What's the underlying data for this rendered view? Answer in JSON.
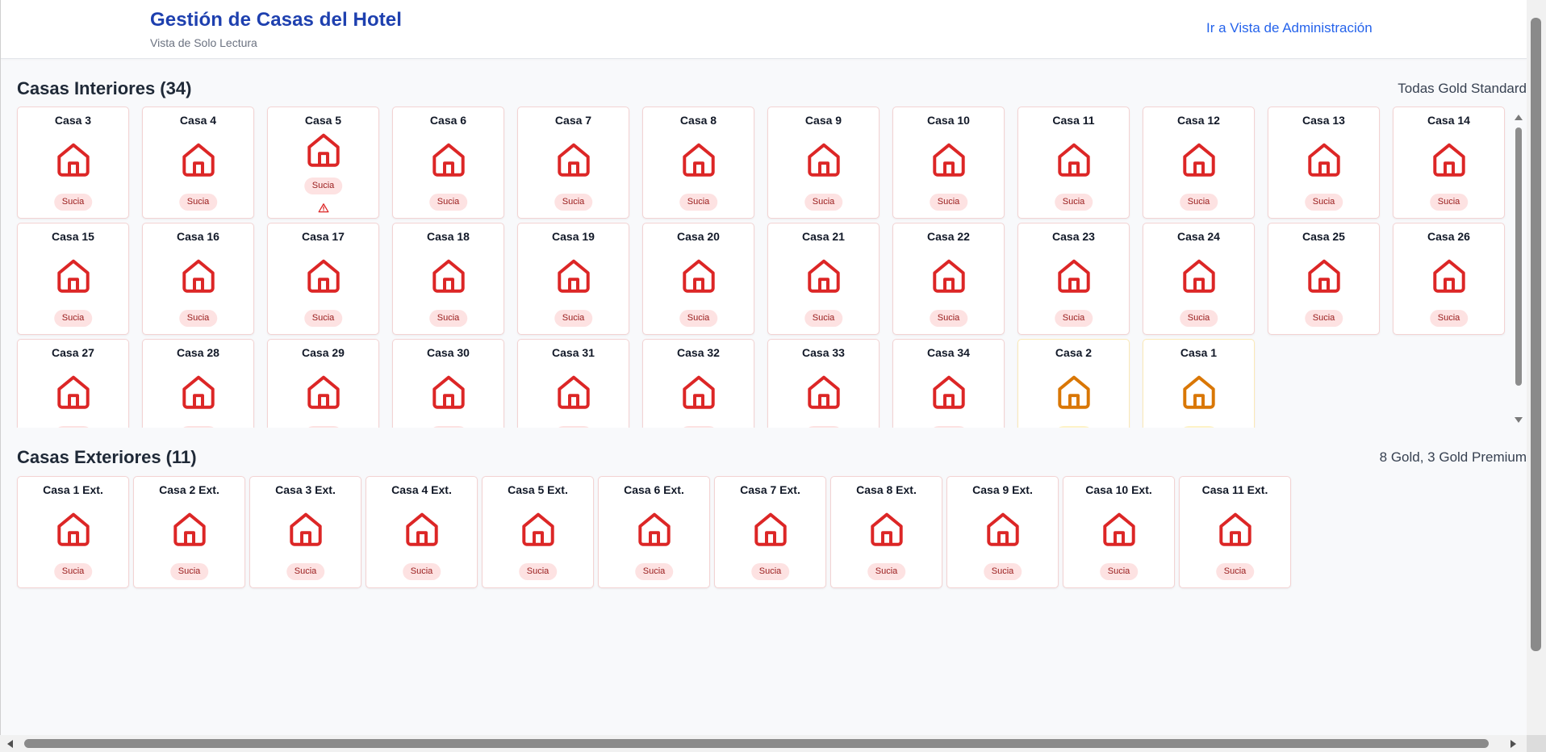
{
  "header": {
    "title": "Gestión de Casas del Hotel",
    "subtitle": "Vista de Solo Lectura",
    "admin_link": "Ir a Vista de Administración"
  },
  "colors": {
    "dirty_icon": "#dc2626",
    "warning_icon": "#d97706",
    "title_blue": "#1e40af",
    "link_blue": "#2563eb"
  },
  "interior": {
    "title": "Casas Interiores (34)",
    "meta": "Todas Gold Standard",
    "houses": [
      {
        "name": "Casa 3",
        "status": "Sucia",
        "tone": "red",
        "alert": false
      },
      {
        "name": "Casa 4",
        "status": "Sucia",
        "tone": "red",
        "alert": false
      },
      {
        "name": "Casa 5",
        "status": "Sucia",
        "tone": "red",
        "alert": true
      },
      {
        "name": "Casa 6",
        "status": "Sucia",
        "tone": "red",
        "alert": false
      },
      {
        "name": "Casa 7",
        "status": "Sucia",
        "tone": "red",
        "alert": false
      },
      {
        "name": "Casa 8",
        "status": "Sucia",
        "tone": "red",
        "alert": false
      },
      {
        "name": "Casa 9",
        "status": "Sucia",
        "tone": "red",
        "alert": false
      },
      {
        "name": "Casa 10",
        "status": "Sucia",
        "tone": "red",
        "alert": false
      },
      {
        "name": "Casa 11",
        "status": "Sucia",
        "tone": "red",
        "alert": false
      },
      {
        "name": "Casa 12",
        "status": "Sucia",
        "tone": "red",
        "alert": false
      },
      {
        "name": "Casa 13",
        "status": "Sucia",
        "tone": "red",
        "alert": false
      },
      {
        "name": "Casa 14",
        "status": "Sucia",
        "tone": "red",
        "alert": false
      },
      {
        "name": "Casa 15",
        "status": "Sucia",
        "tone": "red",
        "alert": false
      },
      {
        "name": "Casa 16",
        "status": "Sucia",
        "tone": "red",
        "alert": false
      },
      {
        "name": "Casa 17",
        "status": "Sucia",
        "tone": "red",
        "alert": false
      },
      {
        "name": "Casa 18",
        "status": "Sucia",
        "tone": "red",
        "alert": false
      },
      {
        "name": "Casa 19",
        "status": "Sucia",
        "tone": "red",
        "alert": false
      },
      {
        "name": "Casa 20",
        "status": "Sucia",
        "tone": "red",
        "alert": false
      },
      {
        "name": "Casa 21",
        "status": "Sucia",
        "tone": "red",
        "alert": false
      },
      {
        "name": "Casa 22",
        "status": "Sucia",
        "tone": "red",
        "alert": false
      },
      {
        "name": "Casa 23",
        "status": "Sucia",
        "tone": "red",
        "alert": false
      },
      {
        "name": "Casa 24",
        "status": "Sucia",
        "tone": "red",
        "alert": false
      },
      {
        "name": "Casa 25",
        "status": "Sucia",
        "tone": "red",
        "alert": false
      },
      {
        "name": "Casa 26",
        "status": "Sucia",
        "tone": "red",
        "alert": false
      },
      {
        "name": "Casa 27",
        "status": "",
        "tone": "red",
        "alert": false
      },
      {
        "name": "Casa 28",
        "status": "",
        "tone": "red",
        "alert": false
      },
      {
        "name": "Casa 29",
        "status": "",
        "tone": "red",
        "alert": false
      },
      {
        "name": "Casa 30",
        "status": "",
        "tone": "red",
        "alert": false
      },
      {
        "name": "Casa 31",
        "status": "",
        "tone": "red",
        "alert": false
      },
      {
        "name": "Casa 32",
        "status": "",
        "tone": "red",
        "alert": false
      },
      {
        "name": "Casa 33",
        "status": "",
        "tone": "red",
        "alert": false
      },
      {
        "name": "Casa 34",
        "status": "",
        "tone": "red",
        "alert": false
      },
      {
        "name": "Casa 2",
        "status": "",
        "tone": "yellow",
        "alert": false
      },
      {
        "name": "Casa 1",
        "status": "",
        "tone": "yellow",
        "alert": false
      }
    ]
  },
  "exterior": {
    "title": "Casas Exteriores (11)",
    "meta": "8 Gold, 3 Gold Premium",
    "houses": [
      {
        "name": "Casa 1 Ext.",
        "status": "Sucia",
        "tone": "red",
        "alert": false
      },
      {
        "name": "Casa 2 Ext.",
        "status": "Sucia",
        "tone": "red",
        "alert": false
      },
      {
        "name": "Casa 3 Ext.",
        "status": "Sucia",
        "tone": "red",
        "alert": false
      },
      {
        "name": "Casa 4 Ext.",
        "status": "Sucia",
        "tone": "red",
        "alert": false
      },
      {
        "name": "Casa 5 Ext.",
        "status": "Sucia",
        "tone": "red",
        "alert": false
      },
      {
        "name": "Casa 6 Ext.",
        "status": "Sucia",
        "tone": "red",
        "alert": false
      },
      {
        "name": "Casa 7 Ext.",
        "status": "Sucia",
        "tone": "red",
        "alert": false
      },
      {
        "name": "Casa 8 Ext.",
        "status": "Sucia",
        "tone": "red",
        "alert": false
      },
      {
        "name": "Casa 9 Ext.",
        "status": "Sucia",
        "tone": "red",
        "alert": false
      },
      {
        "name": "Casa 10 Ext.",
        "status": "Sucia",
        "tone": "red",
        "alert": false
      },
      {
        "name": "Casa 11 Ext.",
        "status": "Sucia",
        "tone": "red",
        "alert": false
      }
    ]
  }
}
